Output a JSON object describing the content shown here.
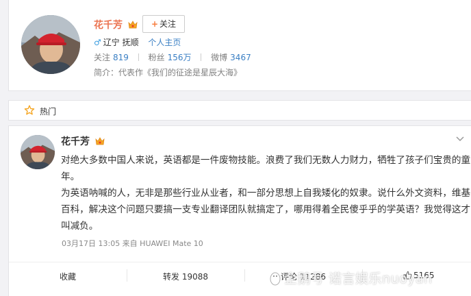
{
  "profile": {
    "name": "花千芳",
    "follow_label": "关注",
    "location": "辽宁 抚顺",
    "homepage_label": "个人主页",
    "stats": [
      {
        "label": "关注",
        "value": "819"
      },
      {
        "label": "粉丝",
        "value": "156万"
      },
      {
        "label": "微博",
        "value": "3467"
      }
    ],
    "bio": "简介：代表作《我们的征途是星辰大海》"
  },
  "hot": {
    "label": "热门"
  },
  "post": {
    "author": "花千芳",
    "paragraphs": [
      "对绝大多数中国人来说，英语都是一件废物技能。浪费了我们无数人力财力，牺牲了孩子们宝贵的童年。",
      "为英语呐喊的人，无非是那些行业从业者，和一部分思想上自我矮化的奴隶。说什么外文资料，维基百科，解决这个问题只要搞一支专业翻译团队就搞定了，哪用得着全民傻乎乎的学英语？我觉得这才叫减负。"
    ],
    "meta": "03月17日 13:05 来自 HUAWEI Mate 10",
    "actions": {
      "collect": "收藏",
      "repost": "转发 19088",
      "comment": "评论 11286",
      "like": "5165"
    }
  },
  "watermark": "企鹅号 诺言娱乐nuoyan",
  "colors": {
    "name": "#eb7350",
    "link": "#3a7fc4",
    "background": "#f2f2f5"
  },
  "icons": [
    "crown-icon",
    "male-icon",
    "star-icon",
    "chevron-down-icon",
    "thumbs-up-icon",
    "penguin-icon"
  ]
}
